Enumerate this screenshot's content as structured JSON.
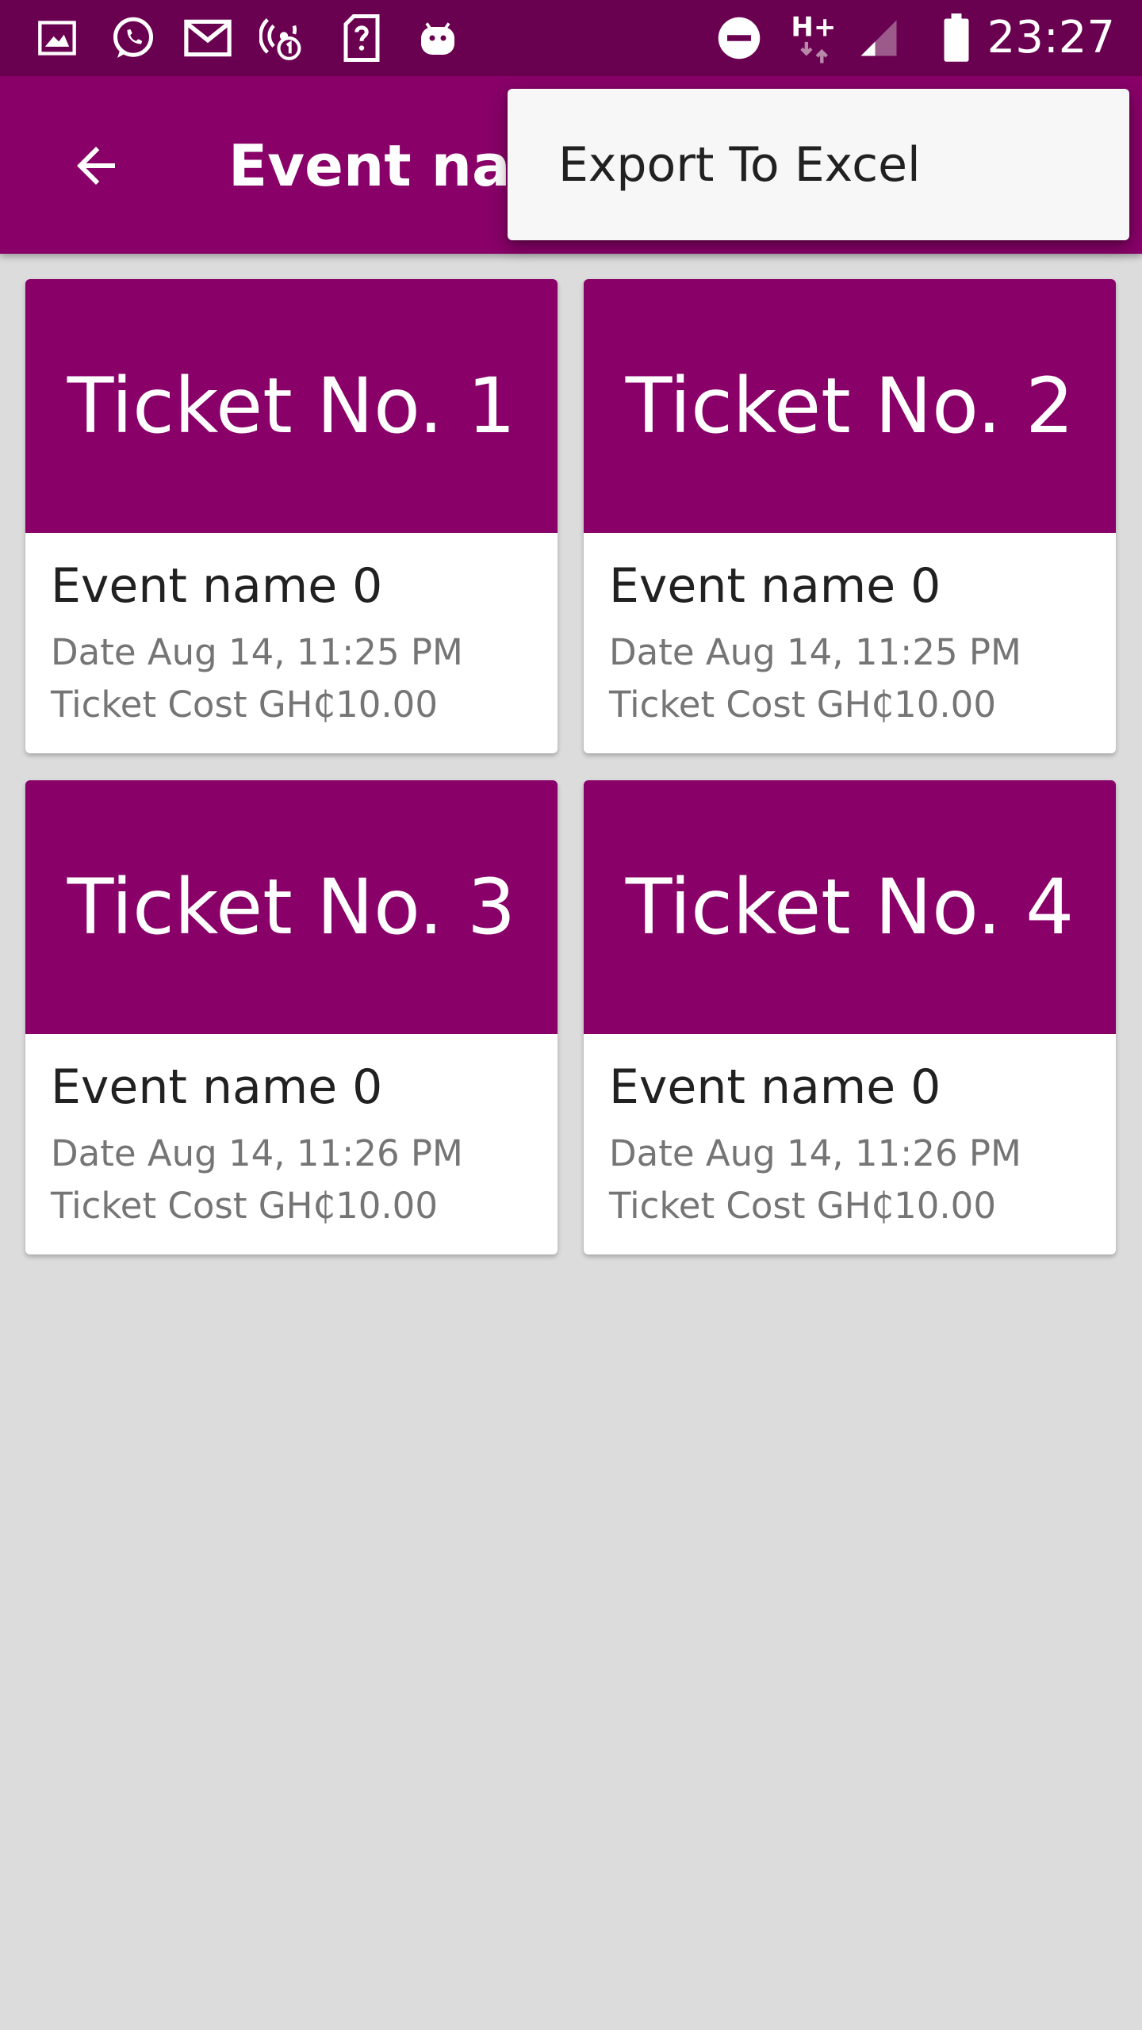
{
  "status_bar": {
    "time": "23:27",
    "network_type": "H+",
    "left_icons": [
      "gallery-icon",
      "whatsapp-icon",
      "gmail-icon",
      "hotspot-icon",
      "sim-unknown-icon",
      "android-icon"
    ],
    "right_icons": [
      "do-not-disturb-icon",
      "network-h-plus-icon",
      "signal-icon",
      "battery-icon"
    ]
  },
  "app_bar": {
    "title": "Event nam",
    "back_icon": "arrow-back-icon"
  },
  "overflow_menu": {
    "items": [
      {
        "label": "Export To Excel"
      }
    ]
  },
  "colors": {
    "status_bar": "#6a0050",
    "primary": "#880068",
    "background": "#dcdcdc",
    "menu_background": "#f7f7f7"
  },
  "tickets": [
    {
      "number": "Ticket No. 1",
      "event": "Event name 0",
      "date": "Date Aug 14, 11:25 PM",
      "cost": "Ticket Cost GH₵10.00"
    },
    {
      "number": "Ticket No. 2",
      "event": "Event name 0",
      "date": "Date Aug 14, 11:25 PM",
      "cost": "Ticket Cost GH₵10.00"
    },
    {
      "number": "Ticket No. 3",
      "event": "Event name 0",
      "date": "Date Aug 14, 11:26 PM",
      "cost": "Ticket Cost GH₵10.00"
    },
    {
      "number": "Ticket No. 4",
      "event": "Event name 0",
      "date": "Date Aug 14, 11:26 PM",
      "cost": "Ticket Cost GH₵10.00"
    }
  ]
}
